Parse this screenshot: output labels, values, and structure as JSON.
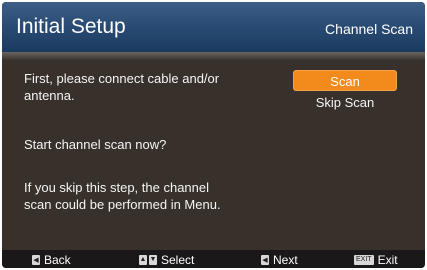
{
  "header": {
    "title": "Initial Setup",
    "page_name": "Channel Scan"
  },
  "content": {
    "instruction": "First, please connect cable and/or\nantenna.",
    "question": "Start channel scan now?",
    "note": "If you skip this step, the channel\nscan could be performed in Menu."
  },
  "buttons": {
    "scan": "Scan",
    "skip_scan": "Skip Scan"
  },
  "footer": {
    "back_label": "Back",
    "select_label": "Select",
    "next_label": "Next",
    "exit_key": "EXIT",
    "exit_label": "Exit"
  },
  "colors": {
    "header": "#294b73",
    "accent": "#f28a1c",
    "background": "#38312b"
  }
}
